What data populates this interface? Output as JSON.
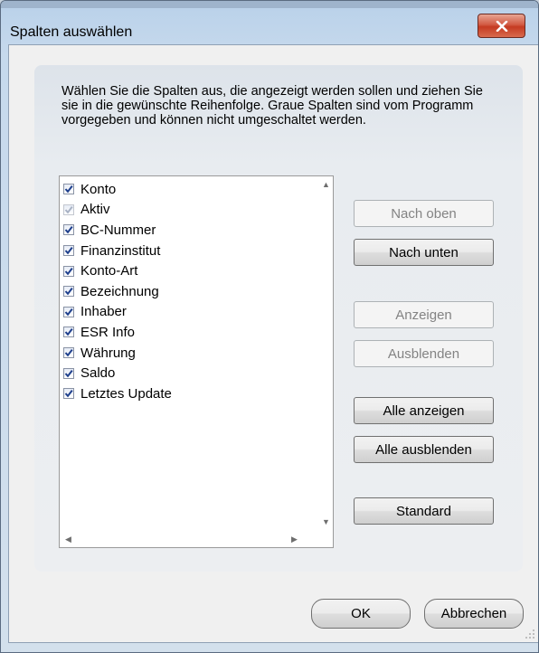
{
  "dialog": {
    "title": "Spalten auswählen",
    "description": "Wählen Sie die Spalten aus, die angezeigt werden sollen und ziehen Sie sie in die gewünschte Reihenfolge. Graue Spalten sind vom Programm vorgegeben und können nicht umgeschaltet werden."
  },
  "columns": [
    {
      "label": "Konto",
      "checked": true,
      "disabled": false
    },
    {
      "label": "Aktiv",
      "checked": true,
      "disabled": true
    },
    {
      "label": "BC-Nummer",
      "checked": true,
      "disabled": false
    },
    {
      "label": "Finanzinstitut",
      "checked": true,
      "disabled": false
    },
    {
      "label": "Konto-Art",
      "checked": true,
      "disabled": false
    },
    {
      "label": "Bezeichnung",
      "checked": true,
      "disabled": false
    },
    {
      "label": "Inhaber",
      "checked": true,
      "disabled": false
    },
    {
      "label": "ESR Info",
      "checked": true,
      "disabled": false
    },
    {
      "label": "Währung",
      "checked": true,
      "disabled": false
    },
    {
      "label": "Saldo",
      "checked": true,
      "disabled": false
    },
    {
      "label": "Letztes Update",
      "checked": true,
      "disabled": false
    }
  ],
  "buttons": {
    "up": "Nach oben",
    "down": "Nach unten",
    "show": "Anzeigen",
    "hide": "Ausblenden",
    "show_all": "Alle anzeigen",
    "hide_all": "Alle ausblenden",
    "standard": "Standard",
    "ok": "OK",
    "cancel": "Abbrechen"
  },
  "colors": {
    "accent_close": "#c53b22",
    "checkmark": "#1e3f8c"
  }
}
